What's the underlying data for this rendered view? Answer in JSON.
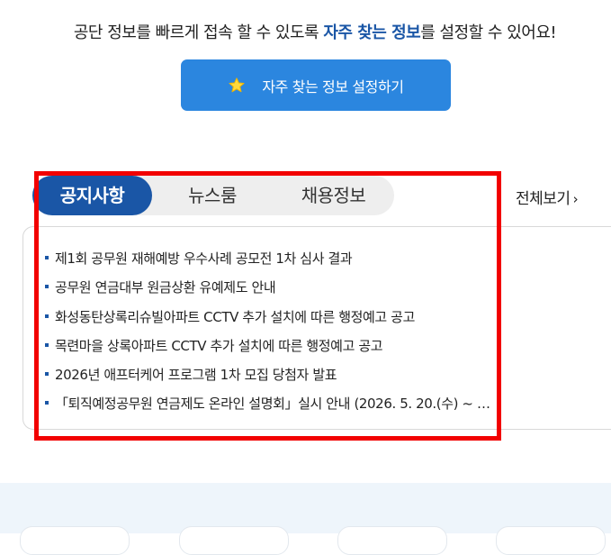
{
  "intro": {
    "prefix": "공단 정보를 빠르게 접속 할 수 있도록 ",
    "highlight": "자주 찾는 정보",
    "suffix": "를 설정할 수 있어요!"
  },
  "favorites_button": {
    "label": "자주 찾는 정보 설정하기",
    "icon": "star-icon"
  },
  "tabs": [
    {
      "label": "공지사항",
      "active": true
    },
    {
      "label": "뉴스룸",
      "active": false
    },
    {
      "label": "채용정보",
      "active": false
    }
  ],
  "more_link": {
    "label": "전체보기",
    "icon": "chevron-right-icon"
  },
  "notices": [
    "제1회 공무원 재해예방 우수사례 공모전 1차 심사 결과",
    "공무원 연금대부 원금상환 유예제도 안내",
    "화성동탄상록리슈빌아파트 CCTV 추가 설치에 따른 행정예고 공고",
    "목련마을 상록아파트 CCTV 추가 설치에 따른 행정예고 공고",
    "2026년 애프터케어 프로그램 1차 모집 당첨자 발표",
    "「퇴직예정공무원 연금제도 온라인 설명회」실시 안내 (2026. 5. 20.(수) ~ …"
  ],
  "colors": {
    "brand_blue": "#1a56a6",
    "button_blue": "#2b86df",
    "highlight_red": "#f20000",
    "tab_bg": "#eeeeee"
  }
}
